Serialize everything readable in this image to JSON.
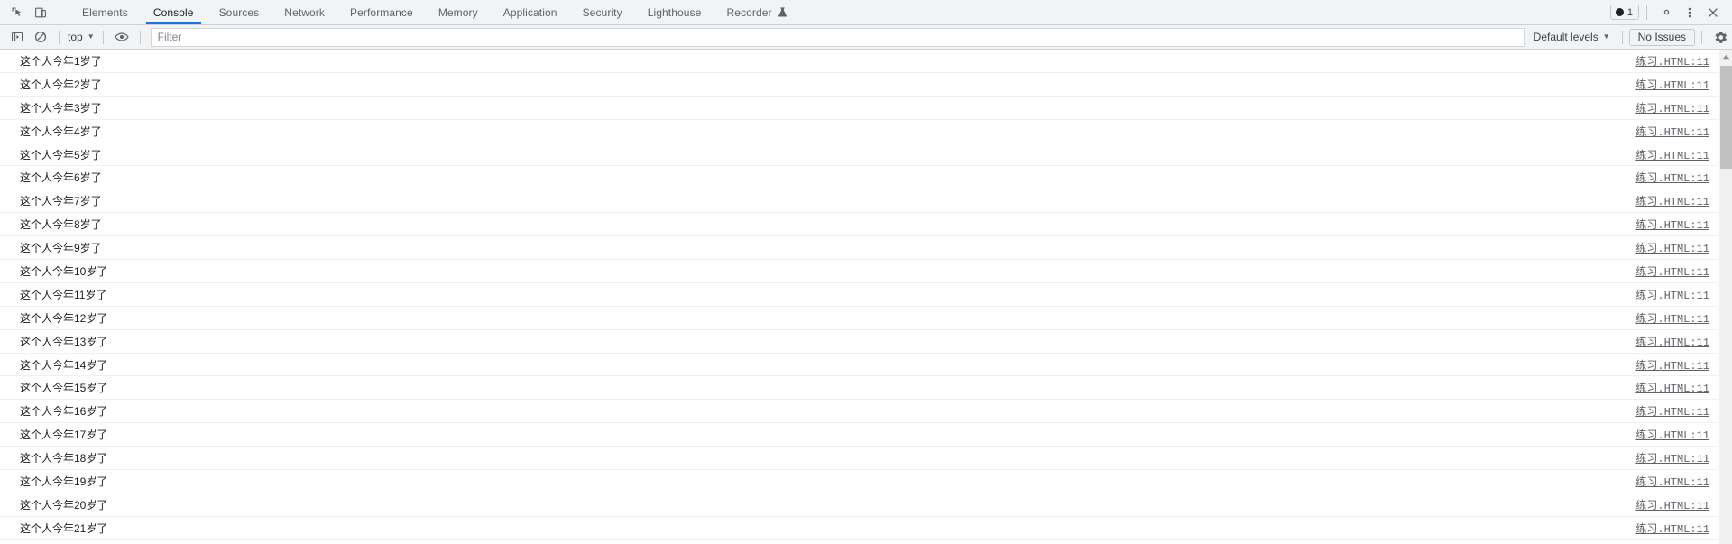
{
  "tabbar": {
    "inspect_icon": "inspect-element-icon",
    "device_icon": "device-toolbar-icon",
    "tabs": [
      {
        "id": "elements",
        "label": "Elements",
        "active": false
      },
      {
        "id": "console",
        "label": "Console",
        "active": true
      },
      {
        "id": "sources",
        "label": "Sources",
        "active": false
      },
      {
        "id": "network",
        "label": "Network",
        "active": false
      },
      {
        "id": "performance",
        "label": "Performance",
        "active": false
      },
      {
        "id": "memory",
        "label": "Memory",
        "active": false
      },
      {
        "id": "application",
        "label": "Application",
        "active": false
      },
      {
        "id": "security",
        "label": "Security",
        "active": false
      },
      {
        "id": "lighthouse",
        "label": "Lighthouse",
        "active": false
      },
      {
        "id": "recorder",
        "label": "Recorder",
        "active": false,
        "experimental": true
      }
    ],
    "issue_badge_count": "1",
    "settings_icon": "gear-icon",
    "more_icon": "kebab-menu-icon",
    "close_icon": "close-icon"
  },
  "console_toolbar": {
    "sidebar_icon": "console-sidebar-icon",
    "clear_icon": "clear-console-icon",
    "context_label": "top",
    "eye_icon": "live-expression-eye-icon",
    "filter_placeholder": "Filter",
    "filter_value": "",
    "levels_label": "Default levels",
    "issues_label": "No Issues",
    "settings_icon": "gear-icon"
  },
  "console_messages": {
    "source": "练习.HTML:11",
    "rows": [
      {
        "text": "这个人今年1岁了"
      },
      {
        "text": "这个人今年2岁了"
      },
      {
        "text": "这个人今年3岁了"
      },
      {
        "text": "这个人今年4岁了"
      },
      {
        "text": "这个人今年5岁了"
      },
      {
        "text": "这个人今年6岁了"
      },
      {
        "text": "这个人今年7岁了"
      },
      {
        "text": "这个人今年8岁了"
      },
      {
        "text": "这个人今年9岁了"
      },
      {
        "text": "这个人今年10岁了"
      },
      {
        "text": "这个人今年11岁了"
      },
      {
        "text": "这个人今年12岁了"
      },
      {
        "text": "这个人今年13岁了"
      },
      {
        "text": "这个人今年14岁了"
      },
      {
        "text": "这个人今年15岁了"
      },
      {
        "text": "这个人今年16岁了"
      },
      {
        "text": "这个人今年17岁了"
      },
      {
        "text": "这个人今年18岁了"
      },
      {
        "text": "这个人今年19岁了"
      },
      {
        "text": "这个人今年20岁了"
      },
      {
        "text": "这个人今年21岁了"
      }
    ]
  },
  "scrollbar": {
    "up_arrow_icon": "scroll-up-arrow-icon"
  },
  "colors": {
    "accent": "#1a73e8",
    "toolbar_bg": "#f1f3f4",
    "text": "#202124",
    "muted": "#5f6368"
  }
}
